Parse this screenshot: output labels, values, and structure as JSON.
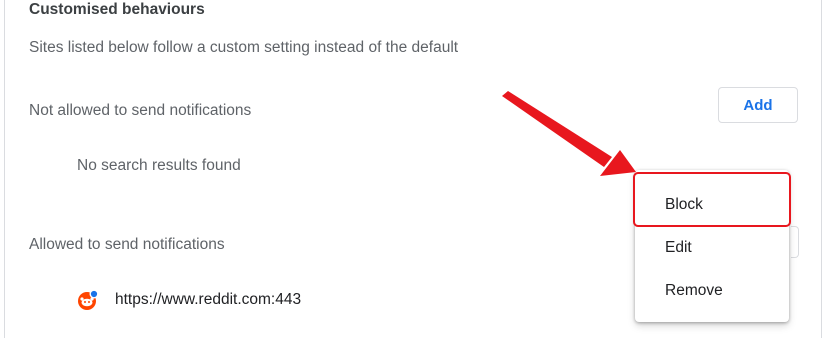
{
  "section": {
    "heading": "Customised behaviours",
    "description": "Sites listed below follow a custom setting instead of the default"
  },
  "not_allowed": {
    "title": "Not allowed to send notifications",
    "add_label": "Add",
    "empty_text": "No search results found"
  },
  "allowed": {
    "title": "Allowed to send notifications",
    "sites": [
      {
        "url": "https://www.reddit.com:443",
        "icon": "reddit-icon"
      }
    ]
  },
  "context_menu": {
    "items": [
      "Block",
      "Edit",
      "Remove"
    ],
    "highlighted": "Block"
  },
  "colors": {
    "accent": "#1a73e8",
    "annotation": "#e8171e",
    "reddit_orange": "#ff4500"
  }
}
